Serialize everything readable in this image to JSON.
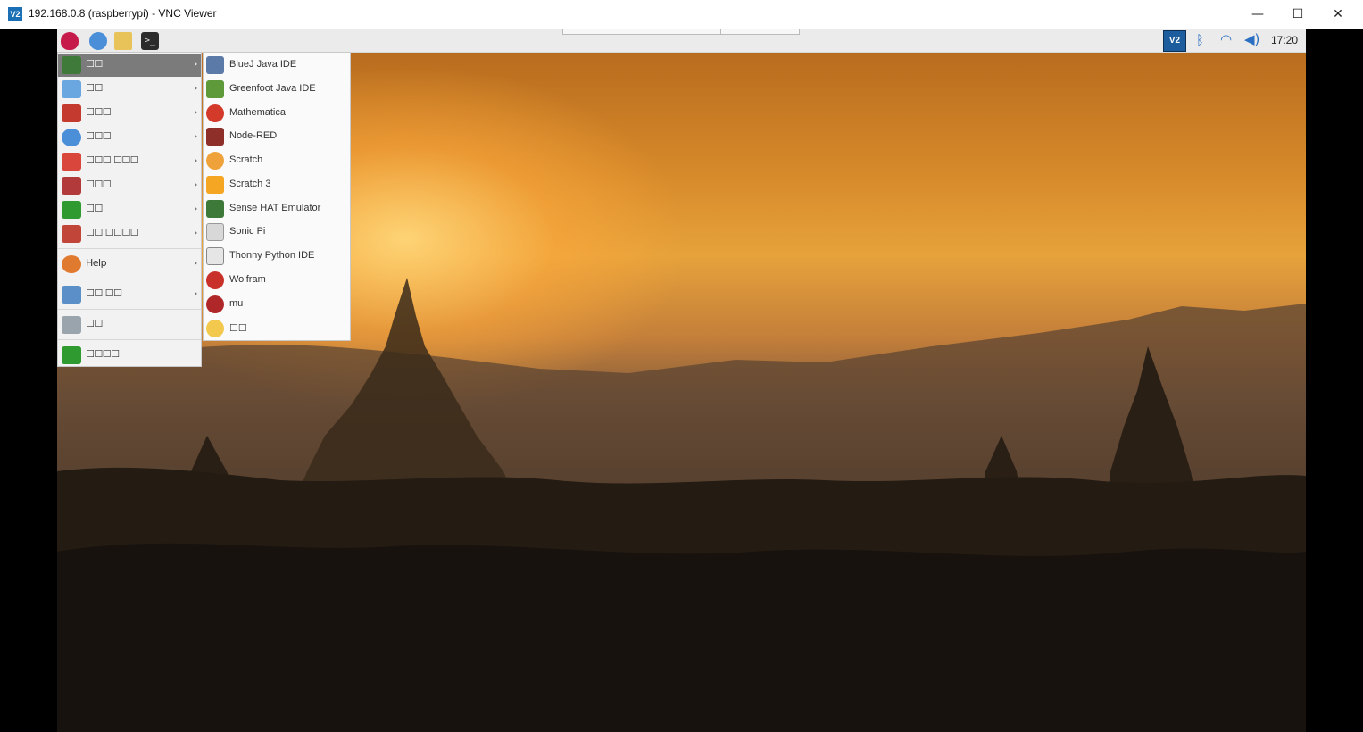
{
  "window": {
    "app_icon_text": "V2",
    "title": "192.168.0.8 (raspberrypi) - VNC Viewer",
    "minimize": "—",
    "maximize": "☐",
    "close": "✕"
  },
  "taskbar": {
    "launchers": [
      {
        "name": "raspberry-menu-icon"
      },
      {
        "name": "web-browser-icon"
      },
      {
        "name": "file-manager-icon"
      },
      {
        "name": "terminal-icon",
        "glyph": ">_"
      }
    ],
    "tray": {
      "vnc_icon_text": "V2",
      "bluetooth_glyph": "ᛒ",
      "wifi_glyph": "◠",
      "volume_glyph": "◀)",
      "clock": "17:20"
    }
  },
  "main_menu": {
    "items": [
      {
        "label": "☐☐",
        "icon": "programming-icon",
        "color": "#3f7a3a",
        "active": true
      },
      {
        "label": "☐☐",
        "icon": "education-icon",
        "color": "#6aa7e0"
      },
      {
        "label": "☐☐☐",
        "icon": "office-icon",
        "color": "#c53a2e"
      },
      {
        "label": "☐☐☐",
        "icon": "internet-icon",
        "color": "#4a8fd8"
      },
      {
        "label": "☐☐☐ ☐☐☐",
        "icon": "sound-video-icon",
        "color": "#d9463b"
      },
      {
        "label": "☐☐☐",
        "icon": "graphics-icon",
        "color": "#b23a3a"
      },
      {
        "label": "☐☐",
        "icon": "games-icon",
        "color": "#2f9a2f"
      },
      {
        "label": "☐☐ ☐☐☐☐",
        "icon": "accessories-icon",
        "color": "#c2453a"
      },
      {
        "label": "Help",
        "icon": "help-icon",
        "color": "#e07a2e"
      },
      {
        "label": "☐☐ ☐☐",
        "icon": "preferences-icon",
        "color": "#5a8fc7"
      },
      {
        "label": "☐☐",
        "icon": "run-icon",
        "color": "#9aa4ad"
      },
      {
        "label": "☐☐☐☐",
        "icon": "shutdown-icon",
        "color": "#2f9a2f"
      }
    ]
  },
  "programming_menu": {
    "items": [
      {
        "label": "BlueJ Java IDE",
        "icon": "bluej-icon",
        "color": "#5c7aa8"
      },
      {
        "label": "Greenfoot Java IDE",
        "icon": "greenfoot-icon",
        "color": "#5e9a3a"
      },
      {
        "label": "Mathematica",
        "icon": "mathematica-icon",
        "color": "#d33a2a"
      },
      {
        "label": "Node-RED",
        "icon": "node-red-icon",
        "color": "#8f2f2a"
      },
      {
        "label": "Scratch",
        "icon": "scratch-icon",
        "color": "#f0a23a"
      },
      {
        "label": "Scratch 3",
        "icon": "scratch3-icon",
        "color": "#f5a623"
      },
      {
        "label": "Sense HAT Emulator",
        "icon": "sense-hat-icon",
        "color": "#3d7a3a"
      },
      {
        "label": "Sonic Pi",
        "icon": "sonic-pi-icon",
        "color": "#d8d8d8"
      },
      {
        "label": "Thonny Python IDE",
        "icon": "thonny-icon",
        "color": "#e6e6e6"
      },
      {
        "label": "Wolfram",
        "icon": "wolfram-icon",
        "color": "#c8322a"
      },
      {
        "label": "mu",
        "icon": "mu-icon",
        "color": "#b0272a"
      },
      {
        "label": "☐☐",
        "icon": "pygame-icon",
        "color": "#f2c94c"
      }
    ]
  }
}
